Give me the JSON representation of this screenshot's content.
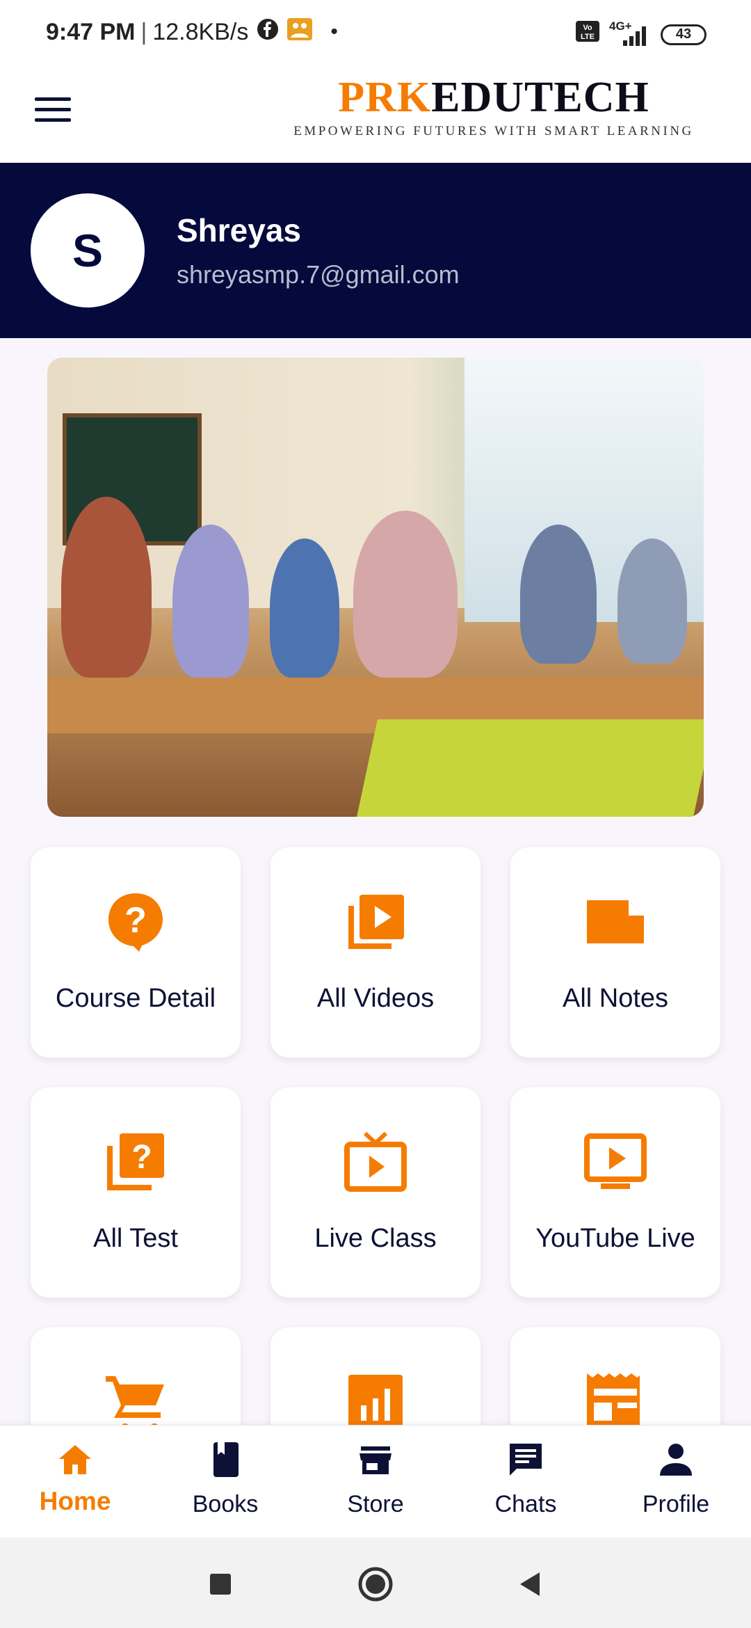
{
  "status_bar": {
    "time": "9:47 PM",
    "speed": "12.8KB/s",
    "network": "4G+",
    "volte": "Vo LTE",
    "battery": "43",
    "icons": [
      "facebook-icon",
      "gallery-notification-icon",
      "dot-icon",
      "volte-icon",
      "signal-icon",
      "battery-icon"
    ]
  },
  "app_bar": {
    "brand_part1": "PRK",
    "brand_part2": "EDUTECH",
    "tagline": "EMPOWERING FUTURES WITH SMART LEARNING",
    "menu_icon": "hamburger-menu-icon"
  },
  "profile": {
    "initial": "S",
    "name": "Shreyas",
    "email": "shreyasmp.7@gmail.com"
  },
  "banner": {
    "description_icon": "classroom-photo"
  },
  "accent_color": "#f57c00",
  "header_color": "#050a3d",
  "features": [
    {
      "label": "Course Detail",
      "icon": "help-bubble-icon"
    },
    {
      "label": "All Videos",
      "icon": "video-library-icon"
    },
    {
      "label": "All Notes",
      "icon": "note-icon"
    },
    {
      "label": "All Test",
      "icon": "quiz-icon"
    },
    {
      "label": "Live Class",
      "icon": "live-tv-icon"
    },
    {
      "label": "YouTube Live",
      "icon": "youtube-play-icon"
    },
    {
      "label": "",
      "icon": "cart-icon"
    },
    {
      "label": "",
      "icon": "bar-chart-icon"
    },
    {
      "label": "",
      "icon": "receipt-icon"
    }
  ],
  "bottom_nav": [
    {
      "label": "Home",
      "icon": "home-icon",
      "active": true
    },
    {
      "label": "Books",
      "icon": "book-icon",
      "active": false
    },
    {
      "label": "Store",
      "icon": "store-icon",
      "active": false
    },
    {
      "label": "Chats",
      "icon": "chat-icon",
      "active": false
    },
    {
      "label": "Profile",
      "icon": "person-icon",
      "active": false
    }
  ],
  "system_nav": [
    "recent-apps-icon",
    "home-circle-icon",
    "back-icon"
  ]
}
